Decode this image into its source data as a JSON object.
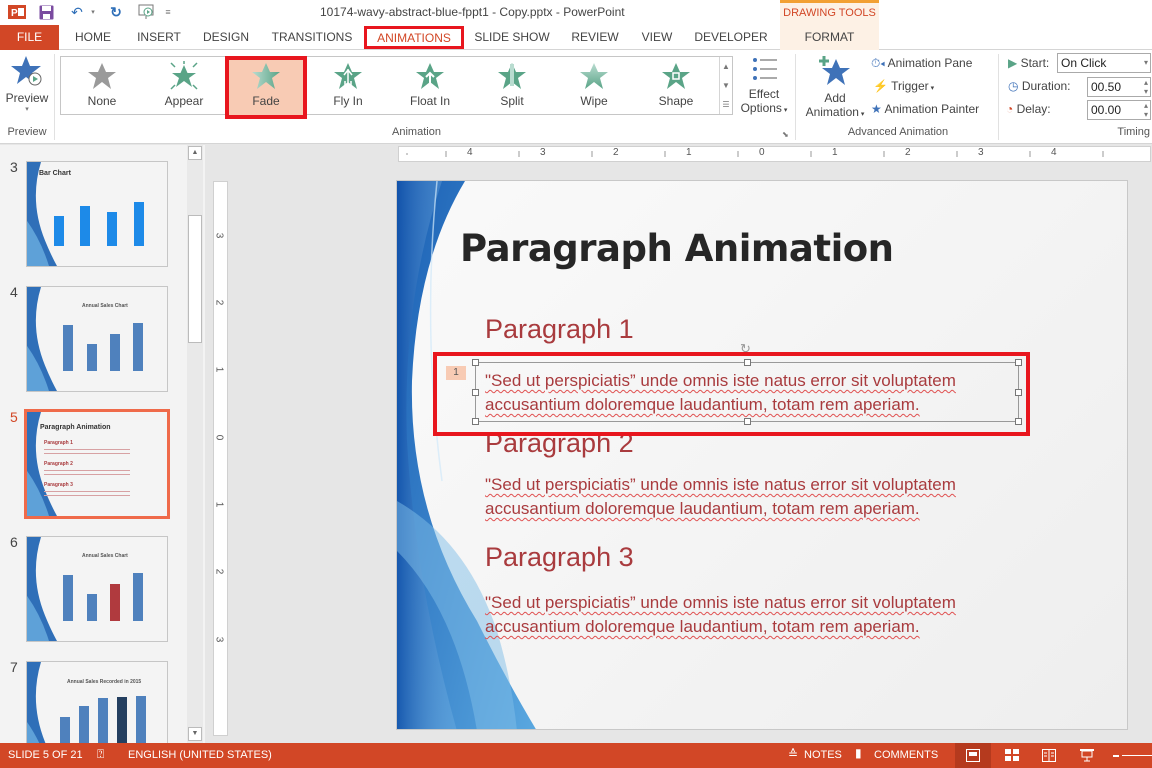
{
  "app": {
    "title": "10174-wavy-abstract-blue-fppt1 - Copy.pptx - PowerPoint"
  },
  "quick_access": [
    "powerpoint-logo",
    "save",
    "undo",
    "redo",
    "start-from-beginning",
    "customize"
  ],
  "context_tab_group": "DRAWING TOOLS",
  "tabs": [
    {
      "label": "FILE"
    },
    {
      "label": "HOME"
    },
    {
      "label": "INSERT"
    },
    {
      "label": "DESIGN"
    },
    {
      "label": "TRANSITIONS"
    },
    {
      "label": "ANIMATIONS",
      "active": true
    },
    {
      "label": "SLIDE SHOW"
    },
    {
      "label": "REVIEW"
    },
    {
      "label": "VIEW"
    },
    {
      "label": "DEVELOPER"
    },
    {
      "label": "FORMAT"
    }
  ],
  "ribbon": {
    "preview": {
      "button": "Preview",
      "group": "Preview"
    },
    "animation_group": "Animation",
    "animations": [
      {
        "label": "None"
      },
      {
        "label": "Appear"
      },
      {
        "label": "Fade",
        "selected": true
      },
      {
        "label": "Fly In"
      },
      {
        "label": "Float In"
      },
      {
        "label": "Split"
      },
      {
        "label": "Wipe"
      },
      {
        "label": "Shape"
      }
    ],
    "effect_options": {
      "line1": "Effect",
      "line2": "Options"
    },
    "add_animation": {
      "line1": "Add",
      "line2": "Animation"
    },
    "animation_pane": "Animation Pane",
    "trigger": "Trigger",
    "animation_painter": "Animation Painter",
    "advanced_group": "Advanced Animation",
    "timing": {
      "group": "Timing",
      "start_label": "Start:",
      "start_value": "On Click",
      "duration_label": "Duration:",
      "duration_value": "00.50",
      "delay_label": "Delay:",
      "delay_value": "00.00"
    }
  },
  "thumbnails": [
    {
      "num": "3",
      "title": "Bar Chart",
      "type": "bar",
      "values": [
        3,
        4,
        3.5,
        4.5
      ]
    },
    {
      "num": "4",
      "title": "Annual Sales Chart",
      "type": "bar",
      "values": [
        4.5,
        2.5,
        3.5,
        4.7
      ]
    },
    {
      "num": "5",
      "title": "Paragraph Animation",
      "selected": true,
      "headings": [
        "Paragraph 1",
        "Paragraph 2",
        "Paragraph 3"
      ]
    },
    {
      "num": "6",
      "title": "Annual Sales Chart",
      "type": "bar",
      "values": [
        4.5,
        2.5,
        3.5,
        4.7
      ],
      "highlight_index": 2
    },
    {
      "num": "7",
      "title": "Annual Sales Recorded in 2015",
      "type": "bar",
      "values": [
        2.5,
        3.5,
        4.2,
        4.3,
        4.4
      ],
      "highlight_index": 3
    }
  ],
  "rulers": {
    "horizontal": [
      "4",
      "3",
      "2",
      "1",
      "0",
      "1",
      "2",
      "3",
      "4"
    ],
    "vertical": [
      "3",
      "2",
      "1",
      "0",
      "1",
      "2",
      "3"
    ]
  },
  "slide": {
    "title": "Paragraph Animation",
    "paragraphs": [
      {
        "heading": "Paragraph 1",
        "line1": "\"Sed ut perspiciatis” unde omnis iste natus error sit voluptatem",
        "line2": "accusantium doloremque laudantium, totam rem aperiam.",
        "animation_order": "1"
      },
      {
        "heading": "Paragraph 2",
        "line1": "\"Sed ut perspiciatis” unde omnis iste natus error sit voluptatem",
        "line2": "accusantium doloremque laudantium, totam rem aperiam."
      },
      {
        "heading": "Paragraph 3",
        "line1": "\"Sed ut perspiciatis” unde omnis iste natus error sit voluptatem",
        "line2": "accusantium doloremque laudantium, totam rem aperiam."
      }
    ]
  },
  "status": {
    "slide_info": "SLIDE 5 OF 21",
    "language": "ENGLISH (UNITED STATES)",
    "notes": "NOTES",
    "comments": "COMMENTS"
  },
  "colors": {
    "accent": "#d24726",
    "highlight": "#e8161e",
    "selected_fill": "#f8cbb4",
    "text_red": "#a93b3e",
    "star_green": "#5aa487"
  }
}
